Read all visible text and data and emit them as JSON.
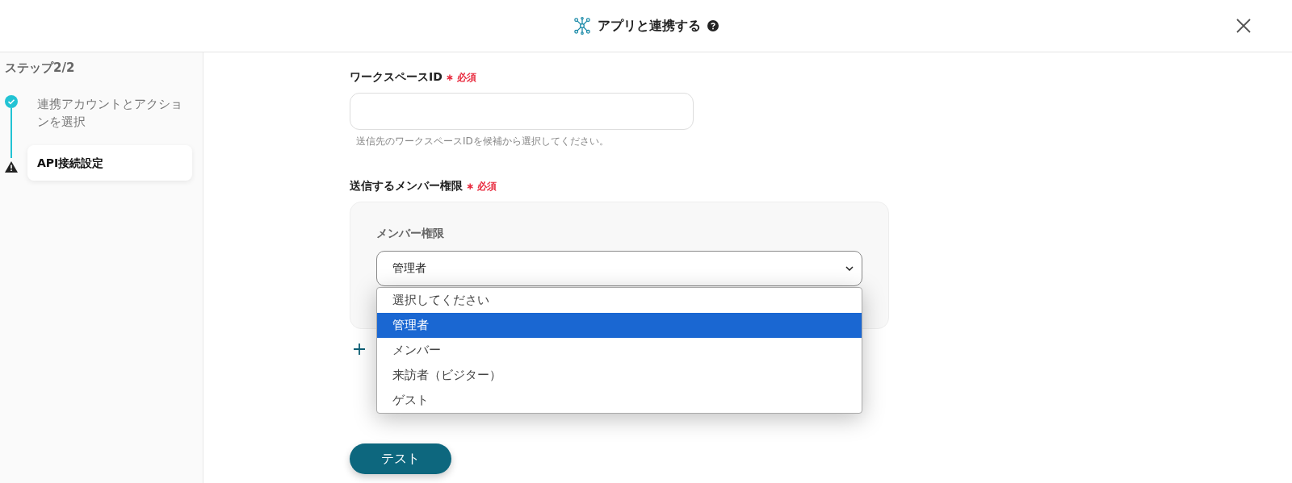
{
  "header": {
    "title": "アプリと連携する",
    "help_icon": true
  },
  "sidebar": {
    "step_label": "ステップ2/2",
    "steps": [
      {
        "label": "連携アカウントとアクションを選択",
        "kind": "done",
        "selected": false
      },
      {
        "label": "API接続設定",
        "kind": "warning",
        "selected": true
      }
    ]
  },
  "form": {
    "workspace_field": {
      "label": "ワークスペースID",
      "required": "∗ 必須",
      "help": "送信先のワークスペースIDを候補から選択してください。"
    },
    "permission_section": {
      "label": "送信するメンバー権限",
      "required": "∗ 必須",
      "card": {
        "label": "メンバー権限",
        "value": "管理者",
        "dropdown": {
          "expanded": true,
          "options": [
            {
              "label": "選択してください",
              "selected": false
            },
            {
              "label": "管理者",
              "selected": true
            },
            {
              "label": "メンバー",
              "selected": false
            },
            {
              "label": "来訪者（ビジター）",
              "selected": false
            },
            {
              "label": "ゲスト",
              "selected": false
            }
          ]
        }
      }
    },
    "test_button": "テスト"
  }
}
